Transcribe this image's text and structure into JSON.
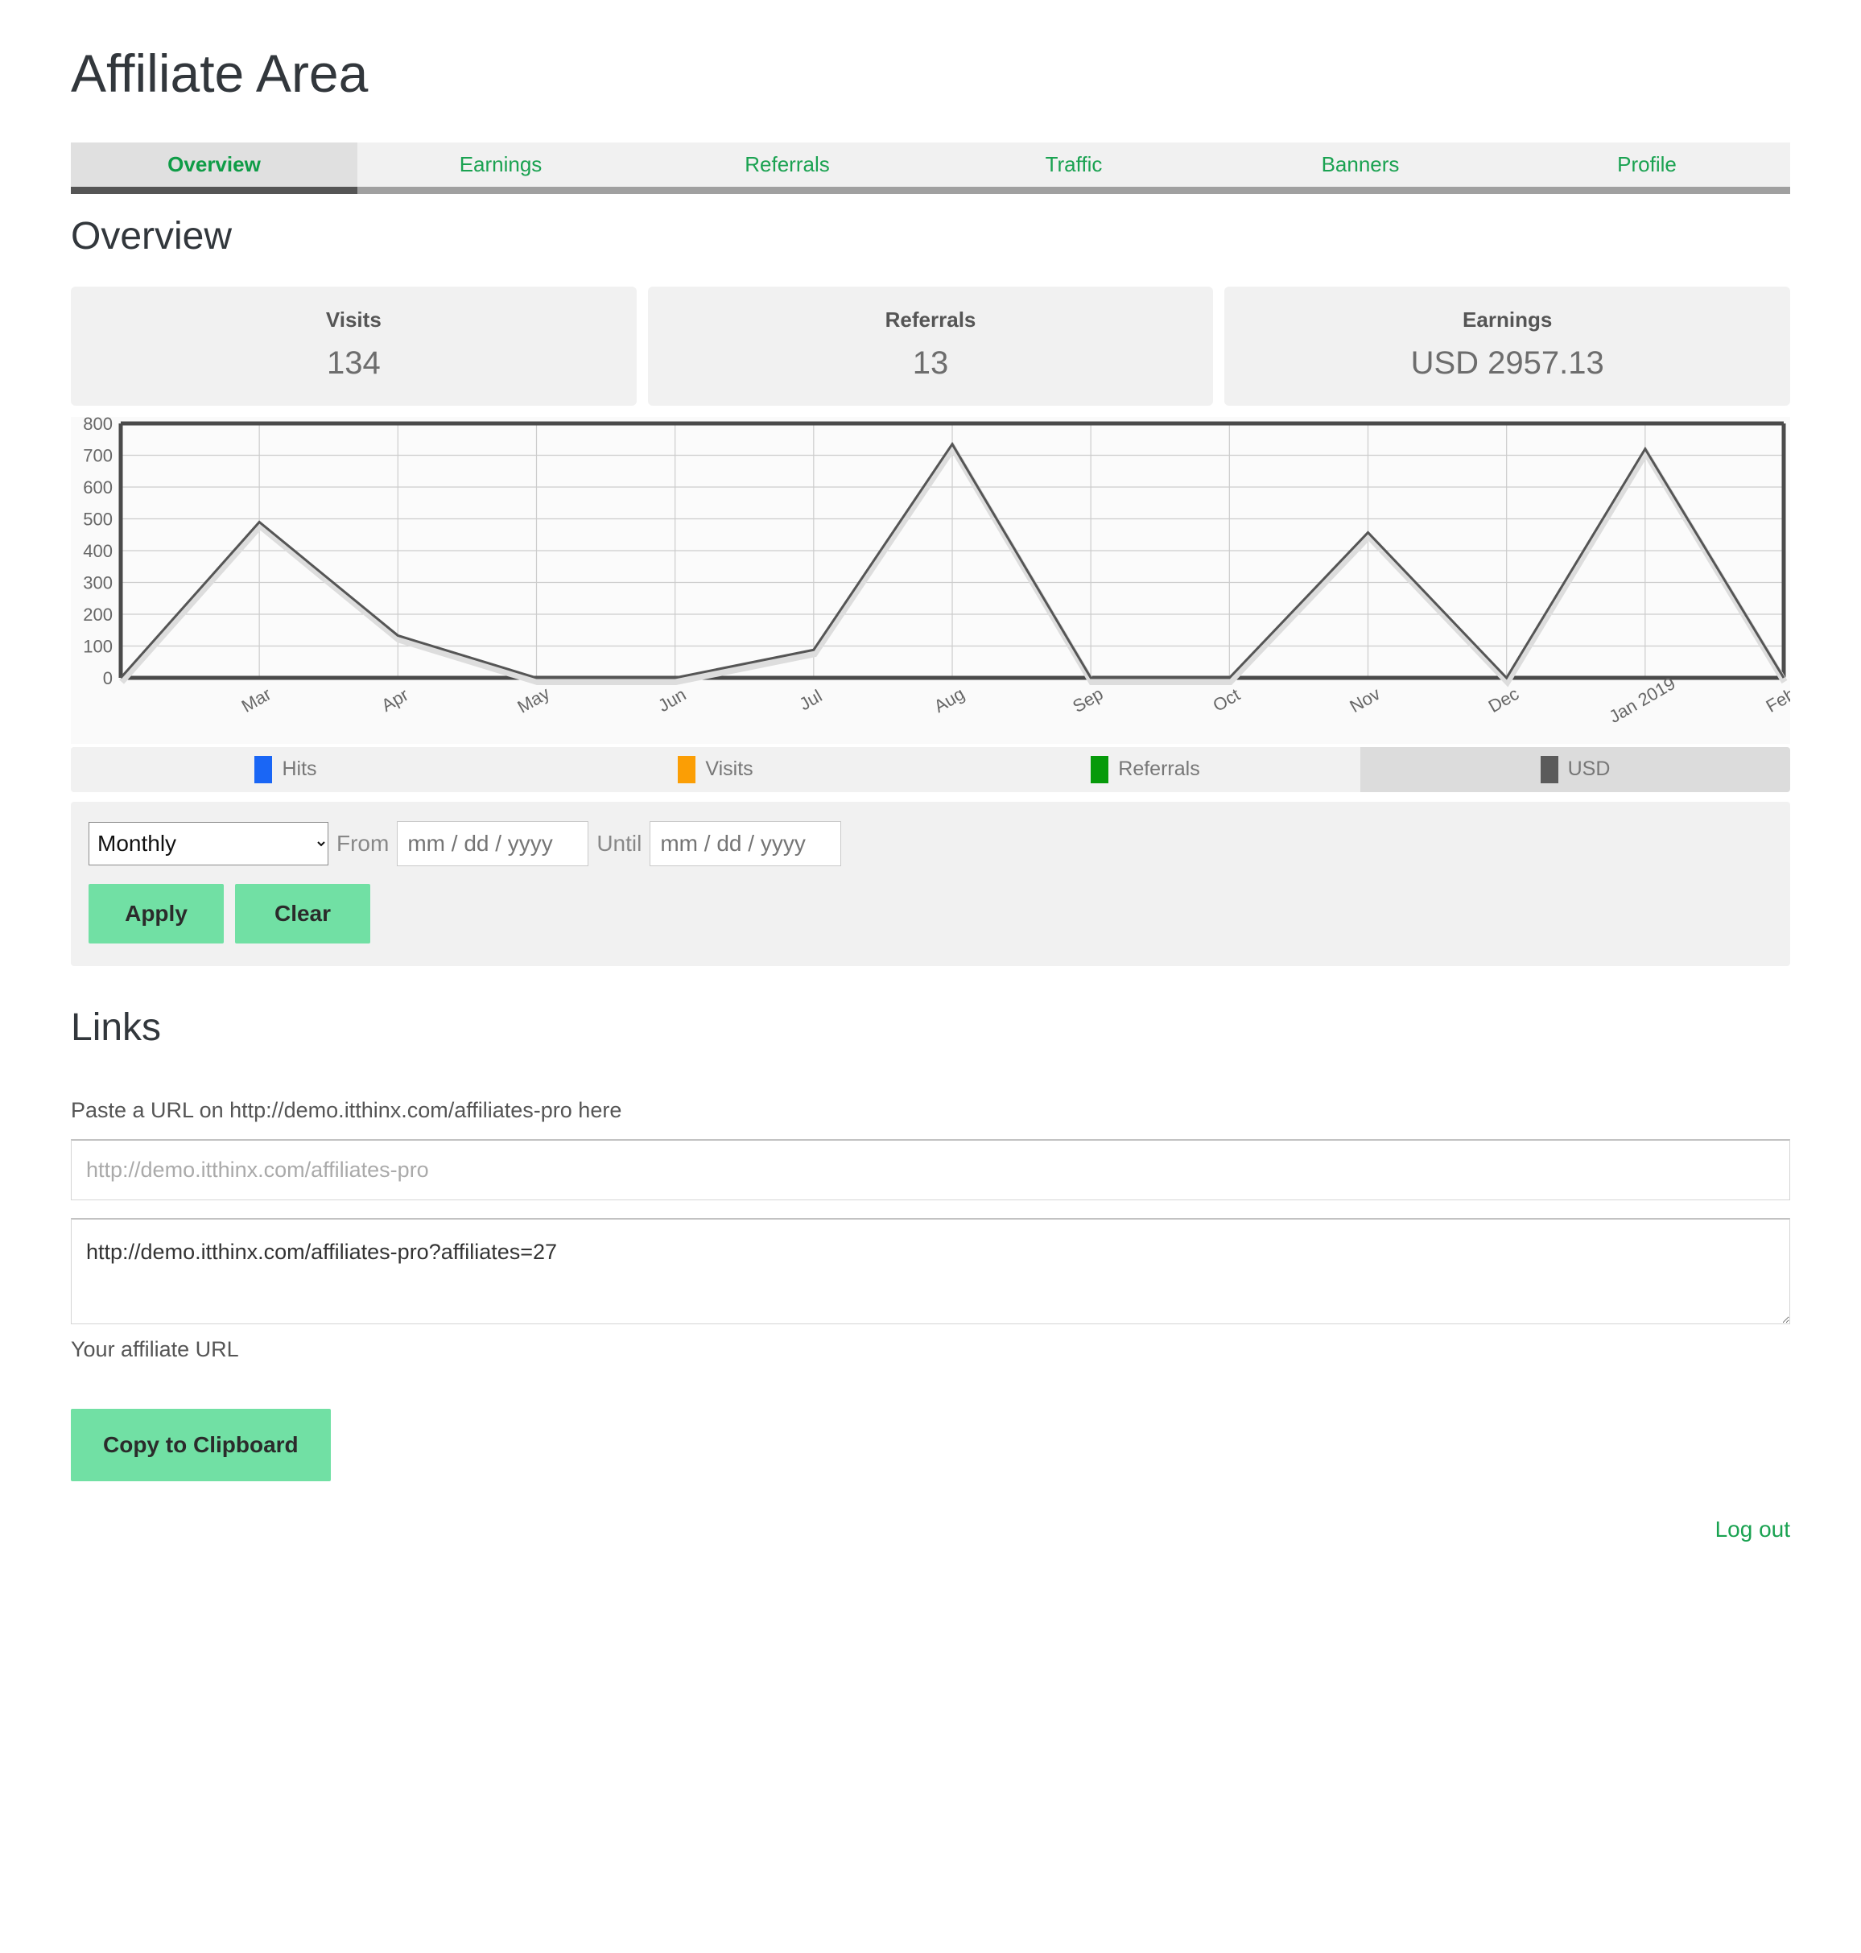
{
  "page": {
    "title": "Affiliate Area",
    "section_title": "Overview",
    "links_title": "Links"
  },
  "tabs": [
    {
      "label": "Overview",
      "active": true
    },
    {
      "label": "Earnings",
      "active": false
    },
    {
      "label": "Referrals",
      "active": false
    },
    {
      "label": "Traffic",
      "active": false
    },
    {
      "label": "Banners",
      "active": false
    },
    {
      "label": "Profile",
      "active": false
    }
  ],
  "stats": [
    {
      "label": "Visits",
      "value": "134"
    },
    {
      "label": "Referrals",
      "value": "13"
    },
    {
      "label": "Earnings",
      "value": "USD 2957.13"
    }
  ],
  "legend": [
    {
      "label": "Hits",
      "color": "#1a66f5",
      "selected": false
    },
    {
      "label": "Visits",
      "color": "#fb9e05",
      "selected": false
    },
    {
      "label": "Referrals",
      "color": "#069a0a",
      "selected": false
    },
    {
      "label": "USD",
      "color": "#5b5b5b",
      "selected": true
    }
  ],
  "filters": {
    "period_selected": "Monthly",
    "period_options": [
      "Monthly"
    ],
    "from_label": "From",
    "until_label": "Until",
    "from_placeholder": "mm / dd / yyyy",
    "from_value": "",
    "until_placeholder": "mm / dd / yyyy",
    "until_value": "",
    "apply_label": "Apply",
    "clear_label": "Clear"
  },
  "links": {
    "paste_help": "Paste a URL on http://demo.itthinx.com/affiliates-pro here",
    "url_placeholder": "http://demo.itthinx.com/affiliates-pro",
    "url_value": "",
    "affiliate_url": "http://demo.itthinx.com/affiliates-pro?affiliates=27",
    "affiliate_caption": "Your affiliate URL",
    "copy_label": "Copy to Clipboard"
  },
  "footer": {
    "logout_label": "Log out"
  },
  "colors": {
    "accent_green": "#1aa251",
    "button_green": "#71e0a4",
    "panel_gray": "#f1f1f1",
    "line_gray": "#555555"
  },
  "chart_data": {
    "type": "line",
    "title": "",
    "xlabel": "",
    "ylabel": "",
    "ylim": [
      0,
      800
    ],
    "ytick_values": [
      0,
      100,
      200,
      300,
      400,
      500,
      600,
      700,
      800
    ],
    "grid": true,
    "legend_position": "bottom",
    "categories": [
      "",
      "Mar",
      "Apr",
      "May",
      "Jun",
      "Jul",
      "Aug",
      "Sep",
      "Oct",
      "Nov",
      "Dec",
      "Jan 2019",
      "Feb"
    ],
    "series": [
      {
        "name": "USD",
        "color": "#555555",
        "values": [
          0,
          490,
          133,
          0,
          0,
          88,
          735,
          0,
          0,
          457,
          0,
          720,
          0
        ]
      }
    ]
  }
}
